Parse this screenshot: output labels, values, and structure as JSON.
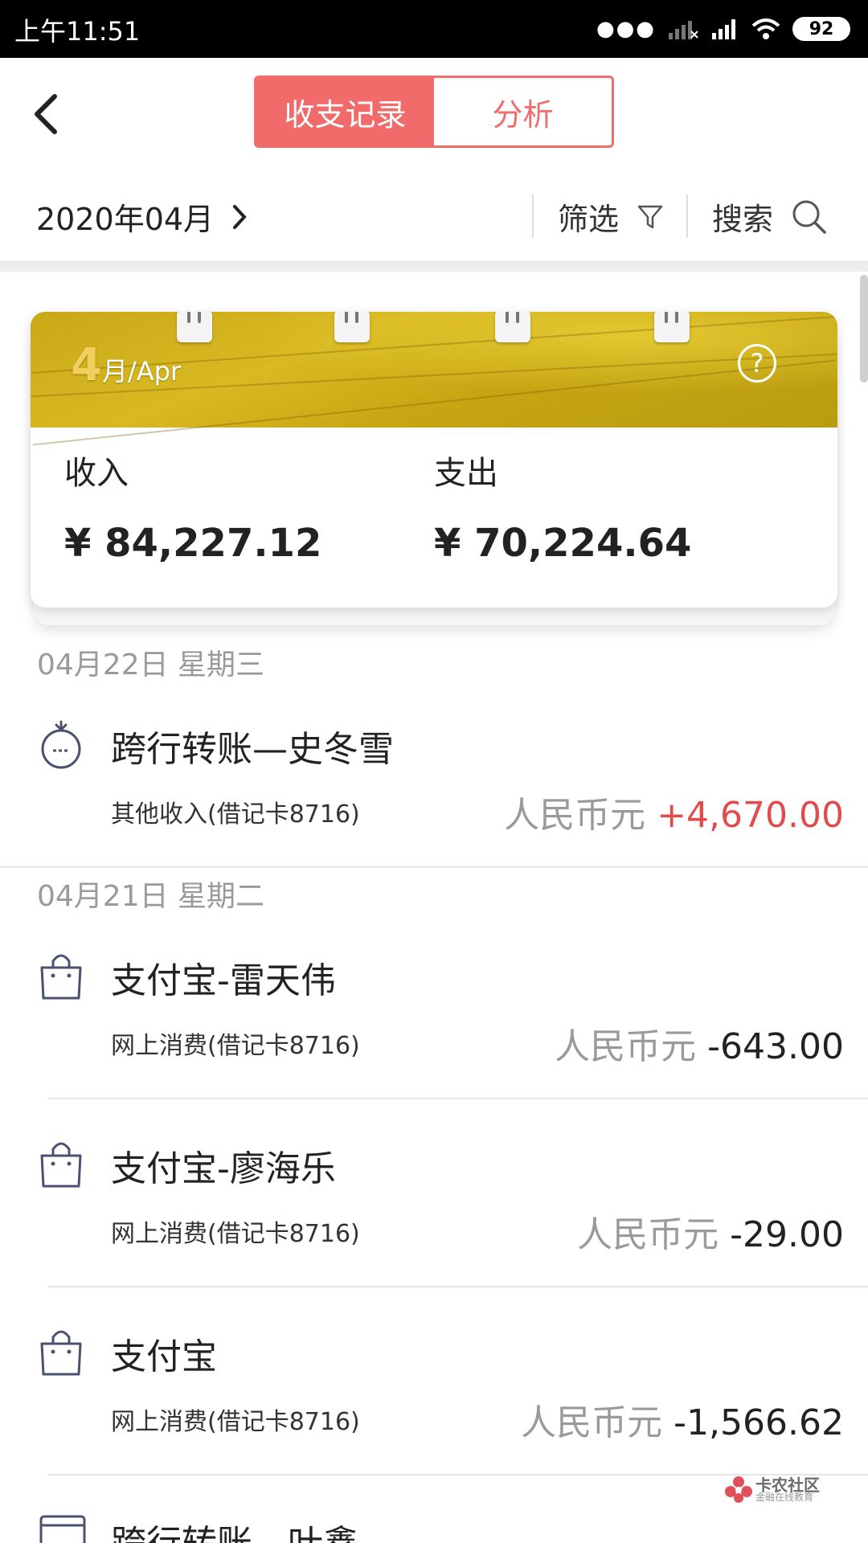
{
  "status_bar": {
    "time": "上午11:51",
    "battery": "92"
  },
  "header": {
    "tabs": [
      {
        "label": "收支记录",
        "active": true
      },
      {
        "label": "分析",
        "active": false
      }
    ]
  },
  "filter_bar": {
    "month": "2020年04月",
    "filter_label": "筛选",
    "search_label": "搜索"
  },
  "summary_card": {
    "month_number": "4",
    "month_suffix": "月/Apr",
    "income_label": "收入",
    "income_amount": "¥ 84,227.12",
    "expense_label": "支出",
    "expense_amount": "¥ 70,224.64"
  },
  "groups": [
    {
      "date": "04月22日 星期三",
      "transactions": [
        {
          "icon": "money-bag-icon",
          "name": "跨行转账—史冬雪",
          "category": "其他收入(借记卡8716)",
          "currency": "人民币元",
          "amount": "+4,670.00",
          "amount_color": "#e24b4b"
        }
      ]
    },
    {
      "date": "04月21日 星期二",
      "transactions": [
        {
          "icon": "shopping-bag-icon",
          "name": "支付宝-雷天伟",
          "category": "网上消费(借记卡8716)",
          "currency": "人民币元",
          "amount": "-643.00",
          "amount_color": "#222222"
        },
        {
          "icon": "shopping-bag-icon",
          "name": "支付宝-廖海乐",
          "category": "网上消费(借记卡8716)",
          "currency": "人民币元",
          "amount": "-29.00",
          "amount_color": "#222222"
        },
        {
          "icon": "shopping-bag-icon",
          "name": "支付宝",
          "category": "网上消费(借记卡8716)",
          "currency": "人民币元",
          "amount": "-1,566.62",
          "amount_color": "#222222"
        },
        {
          "icon": "transfer-card-icon",
          "name": "跨行转账—叶鑫",
          "category": "",
          "currency": "",
          "amount": "",
          "amount_color": "#222222"
        }
      ]
    }
  ],
  "watermark": {
    "title": "卡农社区",
    "subtitle": "金融在线教育"
  },
  "colors": {
    "accent": "#f26b6b",
    "income": "#e24b4b",
    "banner": "#d4b21c",
    "muted": "#9a9a9a"
  }
}
